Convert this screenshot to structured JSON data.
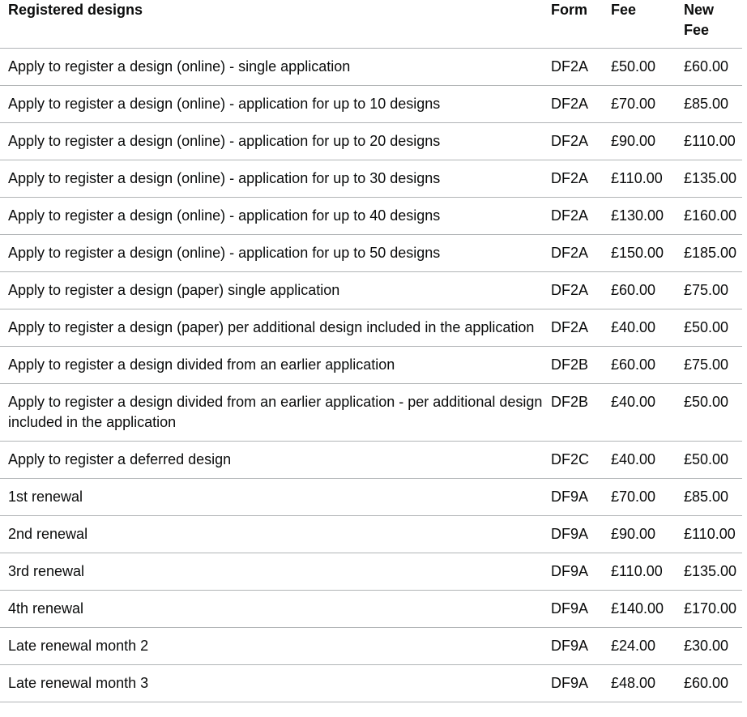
{
  "headers": {
    "description": "Registered designs",
    "form": "Form",
    "fee": "Fee",
    "new_fee": "New Fee"
  },
  "rows": [
    {
      "desc": "Apply to register a design (online) - single application",
      "form": "DF2A",
      "fee": "£50.00",
      "new_fee": "£60.00"
    },
    {
      "desc": "Apply to register a design (online) - application for up to 10 designs",
      "form": "DF2A",
      "fee": "£70.00",
      "new_fee": "£85.00"
    },
    {
      "desc": "Apply to register a design (online) - application for up to 20 designs",
      "form": "DF2A",
      "fee": "£90.00",
      "new_fee": "£110.00"
    },
    {
      "desc": "Apply to register a design (online) - application for up to 30 designs",
      "form": "DF2A",
      "fee": "£110.00",
      "new_fee": "£135.00"
    },
    {
      "desc": "Apply to register a design (online) - application for up to 40 designs",
      "form": "DF2A",
      "fee": "£130.00",
      "new_fee": "£160.00"
    },
    {
      "desc": "Apply to register a design (online) - application for up to 50 designs",
      "form": "DF2A",
      "fee": "£150.00",
      "new_fee": "£185.00"
    },
    {
      "desc": "Apply to register a design (paper) single application",
      "form": "DF2A",
      "fee": "£60.00",
      "new_fee": "£75.00"
    },
    {
      "desc": "Apply to register a design (paper) per additional design included in the application",
      "form": "DF2A",
      "fee": "£40.00",
      "new_fee": "£50.00"
    },
    {
      "desc": "Apply to register a design divided from an earlier application",
      "form": "DF2B",
      "fee": "£60.00",
      "new_fee": "£75.00"
    },
    {
      "desc": "Apply to register a design divided from an earlier application - per additional design included in the application",
      "form": "DF2B",
      "fee": "£40.00",
      "new_fee": "£50.00"
    },
    {
      "desc": "Apply to register a deferred design",
      "form": "DF2C",
      "fee": "£40.00",
      "new_fee": "£50.00"
    },
    {
      "desc": "1st renewal",
      "form": "DF9A",
      "fee": "£70.00",
      "new_fee": "£85.00"
    },
    {
      "desc": "2nd renewal",
      "form": "DF9A",
      "fee": "£90.00",
      "new_fee": "£110.00"
    },
    {
      "desc": "3rd renewal",
      "form": "DF9A",
      "fee": "£110.00",
      "new_fee": "£135.00"
    },
    {
      "desc": "4th renewal",
      "form": "DF9A",
      "fee": "£140.00",
      "new_fee": "£170.00"
    },
    {
      "desc": "Late renewal month 2",
      "form": "DF9A",
      "fee": "£24.00",
      "new_fee": "£30.00"
    },
    {
      "desc": "Late renewal month 3",
      "form": "DF9A",
      "fee": "£48.00",
      "new_fee": "£60.00"
    }
  ]
}
